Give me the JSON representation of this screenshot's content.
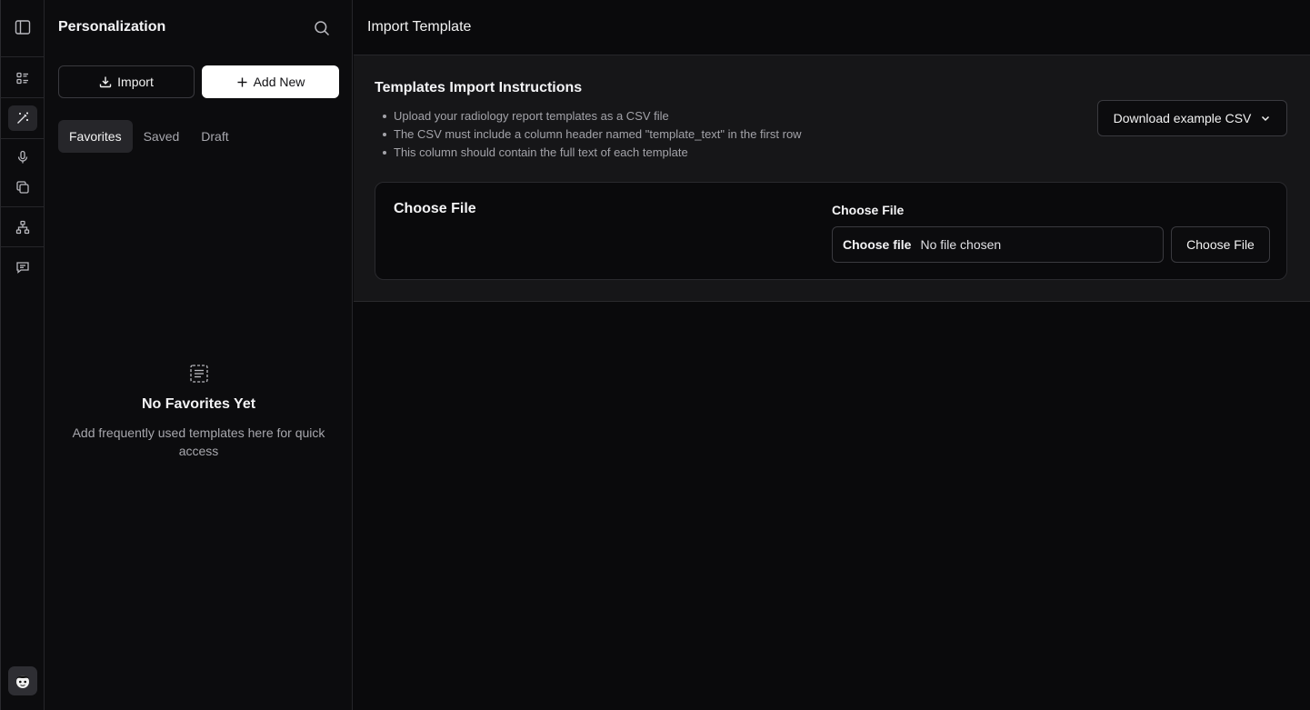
{
  "rail": {
    "items": [
      {
        "icon": "sidebar-toggle-icon"
      },
      {
        "icon": "list-icon"
      },
      {
        "icon": "magic-wand-icon",
        "active": true
      },
      {
        "icon": "microphone-icon"
      },
      {
        "icon": "copy-icon"
      },
      {
        "icon": "sitemap-icon"
      },
      {
        "icon": "message-icon"
      }
    ],
    "avatar_icon": "avatar-icon"
  },
  "sidebar": {
    "title": "Personalization",
    "import_label": "Import",
    "add_new_label": "Add New",
    "tabs": [
      {
        "label": "Favorites",
        "active": true
      },
      {
        "label": "Saved",
        "active": false
      },
      {
        "label": "Draft",
        "active": false
      }
    ],
    "empty": {
      "title": "No Favorites Yet",
      "description": "Add frequently used templates here for quick access"
    }
  },
  "main": {
    "title": "Import Template",
    "instructions_heading": "Templates Import Instructions",
    "instructions": [
      "Upload your radiology report templates as a CSV file",
      "The CSV must include a column header named \"template_text\" in the first row",
      "This column should contain the full text of each template"
    ],
    "download_label": "Download example CSV",
    "file_card": {
      "title": "Choose File",
      "field_label": "Choose File",
      "input_button": "Choose file",
      "input_status": "No file chosen",
      "choose_button": "Choose File"
    }
  },
  "colors": {
    "background": "#0a0a0c",
    "panel": "#161618",
    "border": "#2a2a2e",
    "primary_button": "#ffffff",
    "text": "#f2f2f2",
    "muted_text": "#a3a3a9"
  }
}
